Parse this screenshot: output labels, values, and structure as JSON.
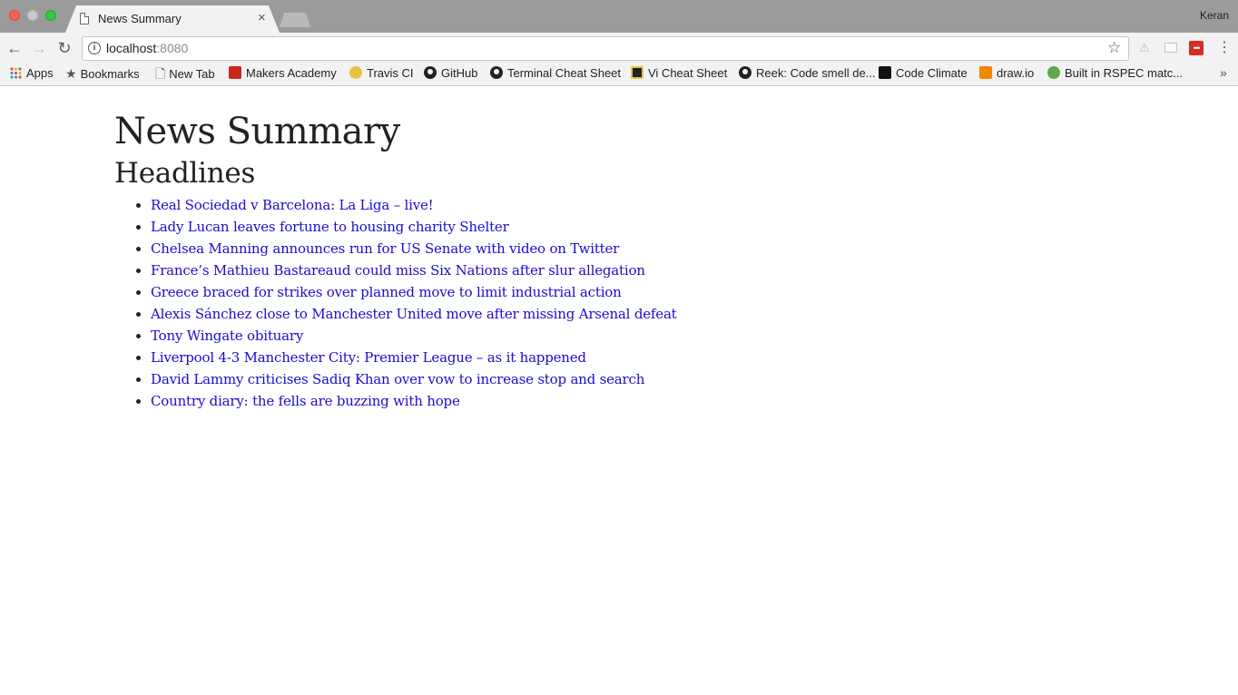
{
  "window": {
    "tab_title": "News Summary",
    "tab_close_glyph": "×",
    "profile_name": "Keran"
  },
  "toolbar": {
    "back_glyph": "←",
    "forward_glyph": "→",
    "reload_glyph": "↻",
    "url_host": "localhost",
    "url_port": ":8080",
    "star_glyph": "☆",
    "lastpass_label": "•••",
    "menu_glyph": "⋮"
  },
  "bookmarks": [
    {
      "label": "Apps",
      "icon": "apps-grid-icon"
    },
    {
      "label": "Bookmarks",
      "icon": "star-icon"
    },
    {
      "label": "New Tab",
      "icon": "page-icon"
    },
    {
      "label": "Makers Academy",
      "icon": "makers-academy-icon"
    },
    {
      "label": "Travis CI",
      "icon": "travis-ci-icon"
    },
    {
      "label": "GitHub",
      "icon": "github-icon"
    },
    {
      "label": "Terminal Cheat Sheet",
      "icon": "github-icon"
    },
    {
      "label": "Vi Cheat Sheet",
      "icon": "vi-icon"
    },
    {
      "label": "Reek: Code smell de...",
      "icon": "github-icon"
    },
    {
      "label": "Code Climate",
      "icon": "code-climate-icon"
    },
    {
      "label": "draw.io",
      "icon": "drawio-icon"
    },
    {
      "label": "Built in RSPEC matc...",
      "icon": "rspec-icon"
    }
  ],
  "bookmarks_overflow_glyph": "»",
  "page": {
    "title": "News Summary",
    "section_title": "Headlines",
    "headlines": [
      "Real Sociedad v Barcelona: La Liga – live!",
      "Lady Lucan leaves fortune to housing charity Shelter",
      "Chelsea Manning announces run for US Senate with video on Twitter",
      "France’s Mathieu Bastareaud could miss Six Nations after slur allegation",
      "Greece braced for strikes over planned move to limit industrial action",
      "Alexis Sánchez close to Manchester United move after missing Arsenal defeat",
      "Tony Wingate obituary",
      "Liverpool 4-3 Manchester City: Premier League – as it happened",
      "David Lammy criticises Sadiq Khan over vow to increase stop and search",
      "Country diary: the fells are buzzing with hope"
    ]
  },
  "colors": {
    "link": "#1a0dcc",
    "heading": "#222222",
    "chrome_bg": "#f2f2f2",
    "titlebar_bg": "#9b9b9b"
  }
}
